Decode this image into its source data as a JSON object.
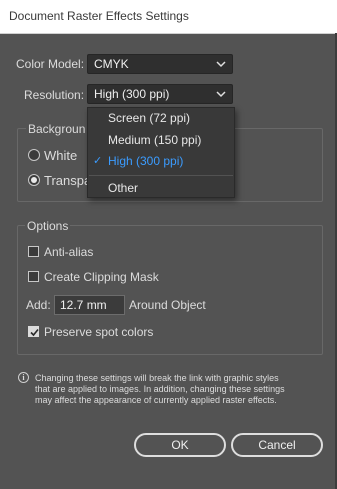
{
  "window": {
    "title": "Document Raster Effects Settings"
  },
  "color_model": {
    "label": "Color Model:",
    "value": "CMYK"
  },
  "resolution": {
    "label": "Resolution:",
    "value": "High (300 ppi)",
    "options": [
      "Screen (72 ppi)",
      "Medium (150 ppi)",
      "High (300 ppi)",
      "Other"
    ],
    "selected": "High (300 ppi)"
  },
  "background": {
    "title_visible": "Backgroun",
    "white_label": "White",
    "transparent_label_visible": "Transpa",
    "selected": "transparent"
  },
  "options": {
    "title": "Options",
    "antialias_label": "Anti-alias",
    "antialias_checked": false,
    "clipping_label": "Create Clipping Mask",
    "clipping_checked": false,
    "add_label": "Add:",
    "add_value": "12.7 mm",
    "around_label": "Around Object",
    "spot_label": "Preserve spot colors",
    "spot_checked": true
  },
  "info": {
    "line1": "Changing these settings will break the link with graphic styles",
    "line2": "that are applied to images. In addition, changing these settings",
    "line3": "may affect the appearance of currently applied raster effects."
  },
  "buttons": {
    "ok": "OK",
    "cancel": "Cancel"
  },
  "colors": {
    "panel": "#535353",
    "accent": "#3b9cff",
    "field": "#2f2f2f"
  }
}
